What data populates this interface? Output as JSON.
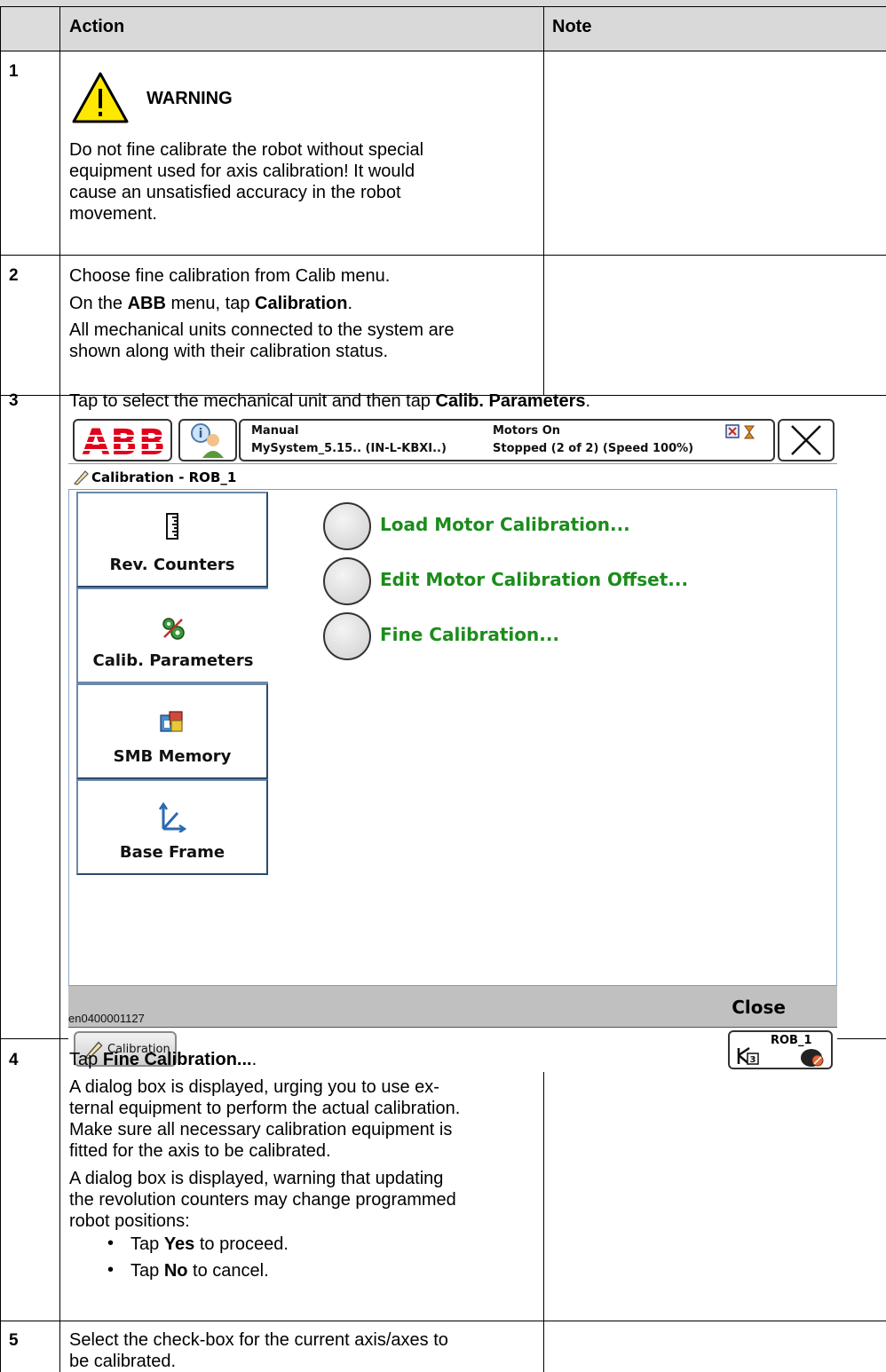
{
  "table": {
    "header": {
      "action": "Action",
      "note": "Note"
    },
    "rows": [
      {
        "num": "1",
        "warning_title": "WARNING",
        "lines": [
          "Do not fine calibrate the robot without special",
          "equipment used for axis calibration! It would",
          "cause an unsatisfied accuracy in the robot",
          "movement."
        ]
      },
      {
        "num": "2",
        "line1": "Choose fine calibration from Calib menu.",
        "line2_pre": "On the ",
        "line2_b1": "ABB",
        "line2_mid": " menu, tap ",
        "line2_b2": "Calibration",
        "line2_end": ".",
        "line3": "All mechanical units connected to the system are",
        "line4": "shown along with their calibration status."
      },
      {
        "num": "3",
        "line_pre": "Tap to select the mechanical unit and then tap ",
        "line_bold": "Calib. Parameters",
        "line_end": ".",
        "caption": "en0400001127"
      },
      {
        "num": "4",
        "line1_pre": "Tap ",
        "line1_bold": "Fine Calibration...",
        "line1_end": ".",
        "para2": [
          "A dialog box is displayed, urging you to use ex-",
          "ternal equipment to perform the actual calibration.",
          "Make sure all necessary calibration equipment is",
          "fitted for the axis to be calibrated."
        ],
        "para3": [
          "A dialog box is displayed, warning that updating",
          "the revolution counters may change programmed",
          "robot positions:"
        ],
        "bullet1_pre": "Tap ",
        "bullet1_bold": "Yes",
        "bullet1_end": " to proceed.",
        "bullet2_pre": "Tap ",
        "bullet2_bold": "No",
        "bullet2_end": " to cancel."
      },
      {
        "num": "5",
        "lines": [
          "Select the check-box for the current axis/axes to",
          "be calibrated."
        ]
      }
    ]
  },
  "flexpendant": {
    "status": {
      "mode": "Manual",
      "system": "MySystem_5.15.. (IN-L-KBXI..)",
      "motors": "Motors On",
      "state": "Stopped (2 of 2) (Speed 100%)"
    },
    "window_title": "Calibration - ROB_1",
    "nav": [
      {
        "label": "Rev. Counters",
        "icon": "ruler-icon"
      },
      {
        "label": "Calib. Parameters",
        "icon": "gears-icon"
      },
      {
        "label": "SMB Memory",
        "icon": "memory-icon"
      },
      {
        "label": "Base Frame",
        "icon": "axes-icon"
      }
    ],
    "options": [
      "Load Motor Calibration...",
      "Edit Motor Calibration Offset...",
      "Fine Calibration..."
    ],
    "close_label": "Close",
    "taskbar_label": "Calibration",
    "rob_label": "ROB_1",
    "colors": {
      "option_text": "#1c8c1c",
      "abb_red": "#e2001a"
    }
  }
}
